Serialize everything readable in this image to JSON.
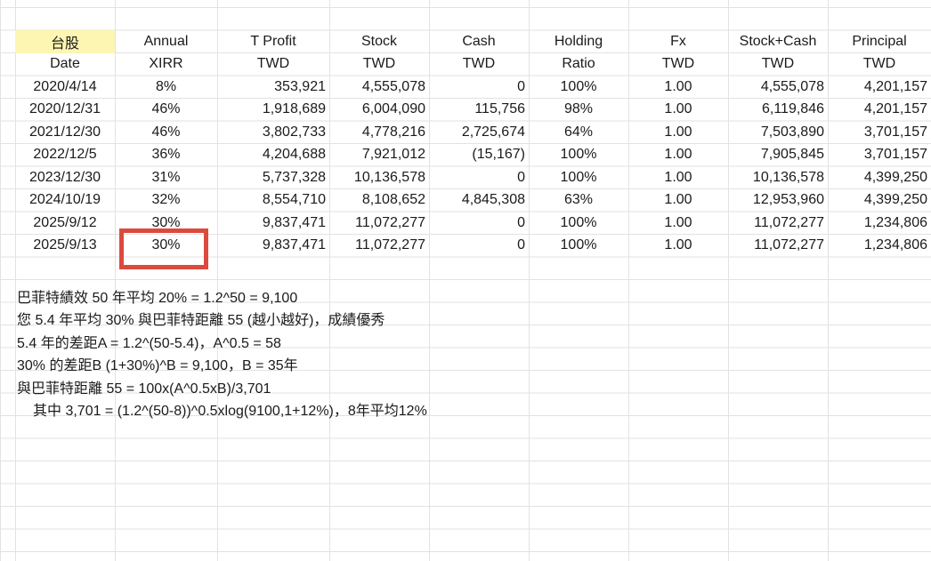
{
  "sheet": {
    "header1": [
      "台股",
      "Annual",
      "T Profit",
      "Stock",
      "Cash",
      "Holding",
      "Fx",
      "Stock+Cash",
      "Principal"
    ],
    "header2": [
      "Date",
      "XIRR",
      "TWD",
      "TWD",
      "TWD",
      "Ratio",
      "TWD",
      "TWD",
      "TWD"
    ],
    "rows": [
      [
        "2020/4/14",
        "8%",
        "353,921",
        "4,555,078",
        "0",
        "100%",
        "1.00",
        "4,555,078",
        "4,201,157"
      ],
      [
        "2020/12/31",
        "46%",
        "1,918,689",
        "6,004,090",
        "115,756",
        "98%",
        "1.00",
        "6,119,846",
        "4,201,157"
      ],
      [
        "2021/12/30",
        "46%",
        "3,802,733",
        "4,778,216",
        "2,725,674",
        "64%",
        "1.00",
        "7,503,890",
        "3,701,157"
      ],
      [
        "2022/12/5",
        "36%",
        "4,204,688",
        "7,921,012",
        "(15,167)",
        "100%",
        "1.00",
        "7,905,845",
        "3,701,157"
      ],
      [
        "2023/12/30",
        "31%",
        "5,737,328",
        "10,136,578",
        "0",
        "100%",
        "1.00",
        "10,136,578",
        "4,399,250"
      ],
      [
        "2024/10/19",
        "32%",
        "8,554,710",
        "8,108,652",
        "4,845,308",
        "63%",
        "1.00",
        "12,953,960",
        "4,399,250"
      ],
      [
        "2025/9/12",
        "30%",
        "9,837,471",
        "11,072,277",
        "0",
        "100%",
        "1.00",
        "11,072,277",
        "1,234,806"
      ],
      [
        "2025/9/13",
        "30%",
        "9,837,471",
        "11,072,277",
        "0",
        "100%",
        "1.00",
        "11,072,277",
        "1,234,806"
      ]
    ]
  },
  "notes": [
    "巴菲特績效 50 年平均 20% = 1.2^50 = 9,100",
    "您 5.4 年平均 30% 與巴菲特距離 55 (越小越好)，成績優秀",
    "5.4 年的差距A = 1.2^(50-5.4)，A^0.5 = 58",
    "30% 的差距B (1+30%)^B = 9,100，B = 35年",
    "與巴菲特距離 55 = 100x(A^0.5xB)/3,701",
    "其中 3,701 = (1.2^(50-8))^0.5xlog(9100,1+12%)，8年平均12%"
  ],
  "colors": {
    "header_highlight": "#fdf6b2",
    "annotation_box": "#dc4a3c",
    "gridline": "#e2e2e2"
  }
}
